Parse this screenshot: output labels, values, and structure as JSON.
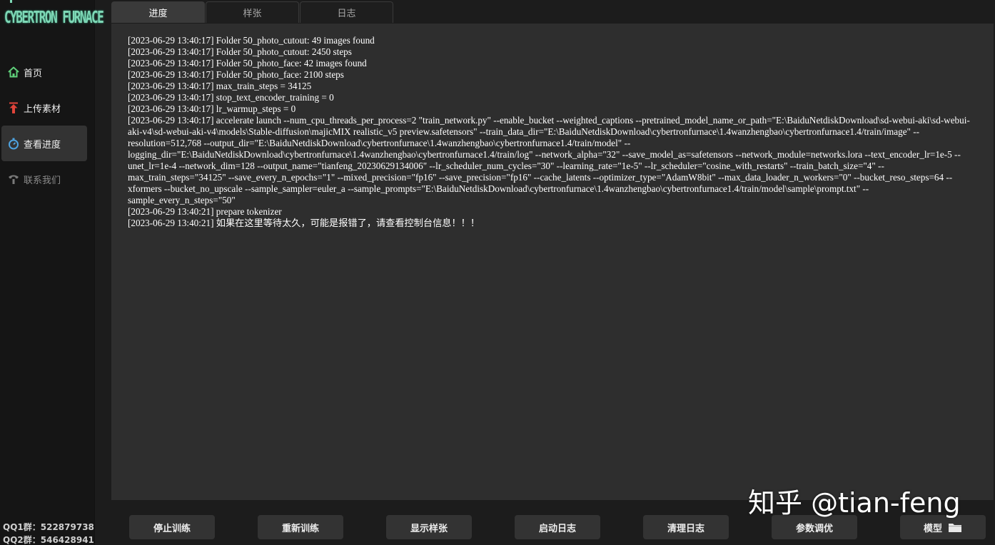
{
  "app": {
    "logo_text": "CYBERTRON FURNACE",
    "accent": "#7ed8b6"
  },
  "sidebar": {
    "items": [
      {
        "label": "首页",
        "icon": "home-icon",
        "active": false
      },
      {
        "label": "上传素材",
        "icon": "upload-icon",
        "active": false
      },
      {
        "label": "查看进度",
        "icon": "stopwatch-icon",
        "active": true
      },
      {
        "label": "联系我们",
        "icon": "phone-icon",
        "active": false
      }
    ],
    "qq1": "QQ1群：522879738",
    "qq2": "QQ2群：546428941"
  },
  "tabs": [
    {
      "label": "进度",
      "active": true
    },
    {
      "label": "样张",
      "active": false
    },
    {
      "label": "日志",
      "active": false
    }
  ],
  "log": {
    "lines": [
      "[2023-06-29 13:40:17] Folder 50_photo_cutout: 49 images found",
      "[2023-06-29 13:40:17] Folder 50_photo_cutout: 2450 steps",
      "[2023-06-29 13:40:17] Folder 50_photo_face: 42 images found",
      "[2023-06-29 13:40:17] Folder 50_photo_face: 2100 steps",
      "[2023-06-29 13:40:17] max_train_steps = 34125",
      "[2023-06-29 13:40:17] stop_text_encoder_training = 0",
      "[2023-06-29 13:40:17] lr_warmup_steps = 0",
      "[2023-06-29 13:40:17] accelerate launch --num_cpu_threads_per_process=2 \"train_network.py\" --enable_bucket --weighted_captions --pretrained_model_name_or_path=\"E:\\BaiduNetdiskDownload\\sd-webui-aki\\sd-webui-aki-v4\\sd-webui-aki-v4\\models\\Stable-diffusion\\majicMIX realistic_v5 preview.safetensors\" --train_data_dir=\"E:\\BaiduNetdiskDownload\\cybertronfurnace\\1.4wanzhengbao\\cybertronfurnace1.4/train/image\" --resolution=512,768 --output_dir=\"E:\\BaiduNetdiskDownload\\cybertronfurnace\\1.4wanzhengbao\\cybertronfurnace1.4/train/model\" --logging_dir=\"E:\\BaiduNetdiskDownload\\cybertronfurnace\\1.4wanzhengbao\\cybertronfurnace1.4/train/log\" --network_alpha=\"32\" --save_model_as=safetensors --network_module=networks.lora --text_encoder_lr=1e-5 --unet_lr=1e-4 --network_dim=128 --output_name=\"tianfeng_20230629134006\" --lr_scheduler_num_cycles=\"30\" --learning_rate=\"1e-5\" --lr_scheduler=\"cosine_with_restarts\" --train_batch_size=\"4\" --max_train_steps=\"34125\" --save_every_n_epochs=\"1\" --mixed_precision=\"fp16\" --save_precision=\"fp16\" --cache_latents --optimizer_type=\"AdamW8bit\" --max_data_loader_n_workers=\"0\" --bucket_reso_steps=64 --xformers --bucket_no_upscale --sample_sampler=euler_a --sample_prompts=\"E:\\BaiduNetdiskDownload\\cybertronfurnace\\1.4wanzhengbao\\cybertronfurnace1.4/train/model\\sample\\prompt.txt\" --sample_every_n_steps=\"50\"",
      "[2023-06-29 13:40:21] prepare tokenizer",
      "[2023-06-29 13:40:21] 如果在这里等待太久，可能是报错了，请查看控制台信息！！！"
    ]
  },
  "buttons": {
    "stop": "停止训练",
    "restart": "重新训练",
    "show_samples": "显示样张",
    "open_log": "启动日志",
    "clear_log": "清理日志",
    "tune_params": "参数调优",
    "model": "模型"
  },
  "watermark": "知乎 @tian-feng"
}
